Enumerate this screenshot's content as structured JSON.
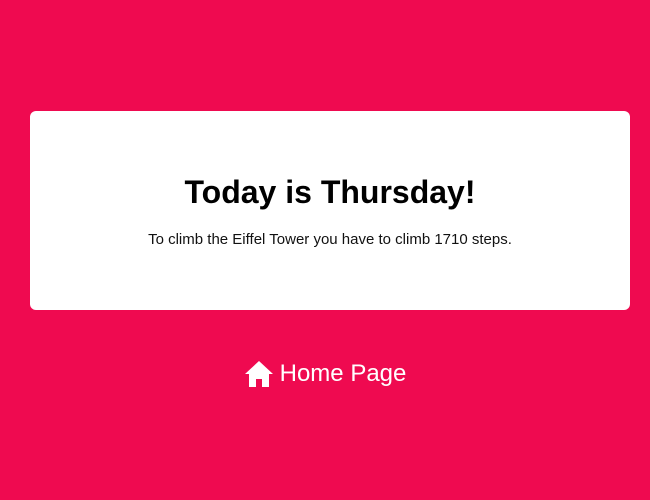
{
  "card": {
    "title": "Today is Thursday!",
    "text": "To climb the Eiffel Tower you have to climb 1710 steps."
  },
  "home_link": {
    "icon": "home-icon",
    "label": "Home Page"
  },
  "colors": {
    "background": "#ef0a50",
    "card": "#ffffff",
    "link": "#ffffff"
  }
}
